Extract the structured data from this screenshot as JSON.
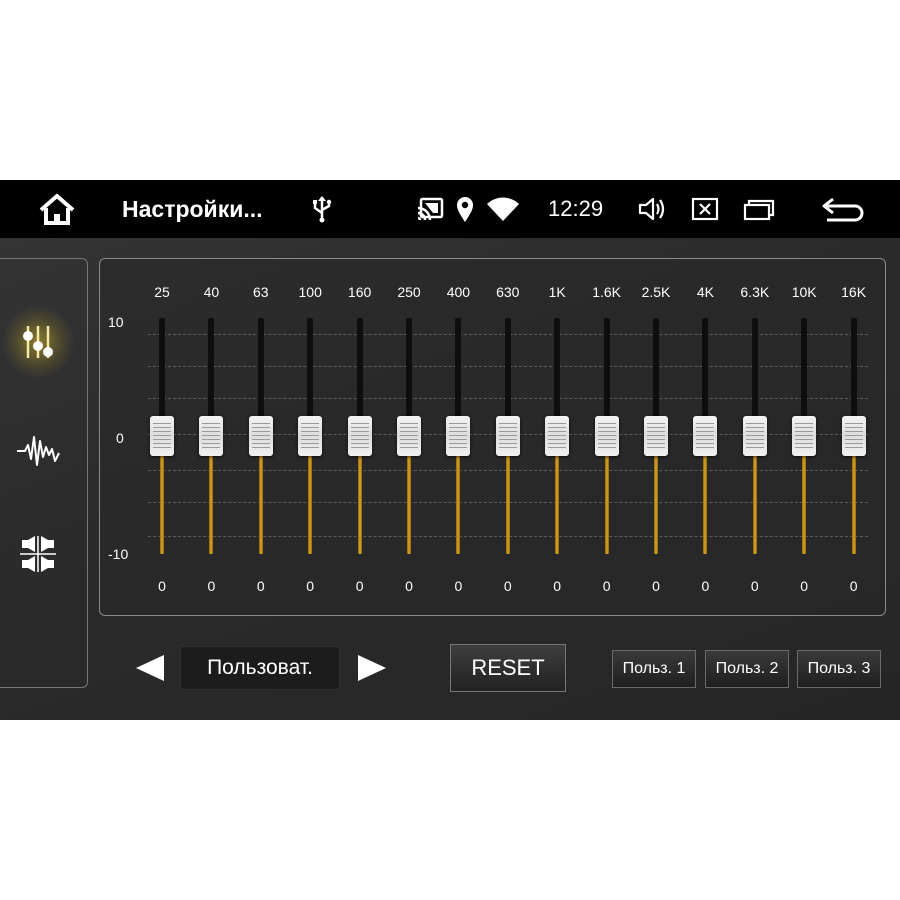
{
  "statusbar": {
    "title": "Настройки...",
    "time": "12:29",
    "icons": [
      "home-icon",
      "usb-icon",
      "cast-icon",
      "location-icon",
      "wifi-icon",
      "volume-icon",
      "close-box-icon",
      "windows-icon",
      "back-icon"
    ]
  },
  "sidebar": {
    "items": [
      {
        "name": "equalizer-sliders-icon",
        "active": true
      },
      {
        "name": "sound-wave-icon",
        "active": false
      },
      {
        "name": "balance-fader-icon",
        "active": false
      }
    ]
  },
  "equalizer": {
    "scale": {
      "max": "10",
      "mid": "0",
      "min": "-10"
    },
    "bands": [
      {
        "freq": "25",
        "value": "0"
      },
      {
        "freq": "40",
        "value": "0"
      },
      {
        "freq": "63",
        "value": "0"
      },
      {
        "freq": "100",
        "value": "0"
      },
      {
        "freq": "160",
        "value": "0"
      },
      {
        "freq": "250",
        "value": "0"
      },
      {
        "freq": "400",
        "value": "0"
      },
      {
        "freq": "630",
        "value": "0"
      },
      {
        "freq": "1K",
        "value": "0"
      },
      {
        "freq": "1.6K",
        "value": "0"
      },
      {
        "freq": "2.5K",
        "value": "0"
      },
      {
        "freq": "4K",
        "value": "0"
      },
      {
        "freq": "6.3K",
        "value": "0"
      },
      {
        "freq": "10K",
        "value": "0"
      },
      {
        "freq": "16K",
        "value": "0"
      }
    ]
  },
  "controls": {
    "preset": "Пользоват.",
    "reset": "RESET",
    "user_presets": [
      "Польз. 1",
      "Польз. 2",
      "Польз. 3"
    ]
  },
  "colors": {
    "accent_gold": "#e0a820",
    "statusbar_bg": "#000000"
  }
}
